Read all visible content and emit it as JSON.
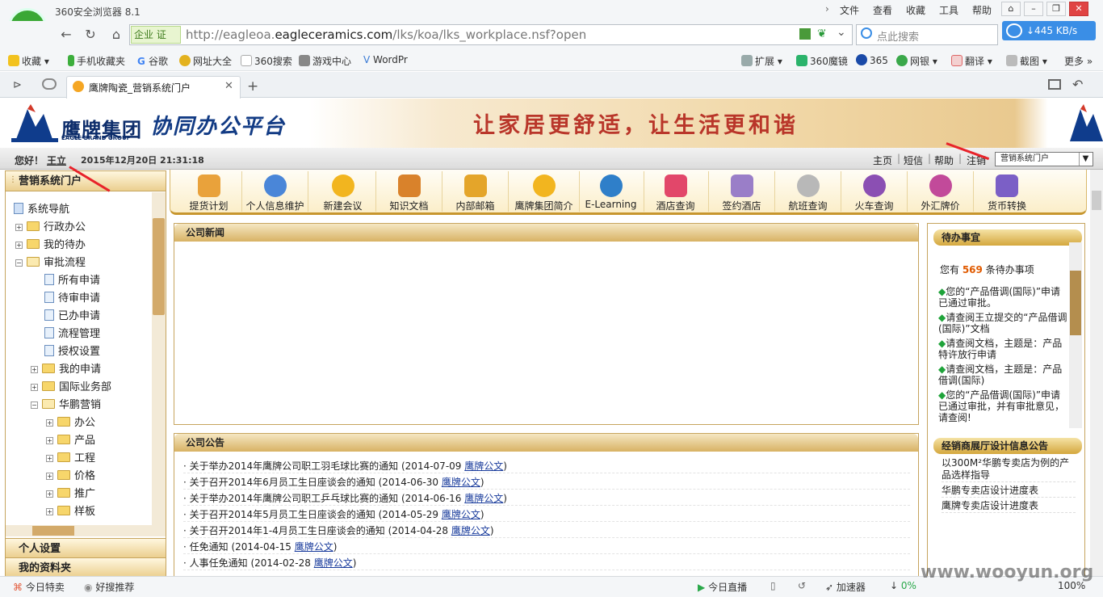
{
  "browser": {
    "title": "360安全浏览器 8.1",
    "menu": [
      "文件",
      "查看",
      "收藏",
      "工具",
      "帮助"
    ],
    "address_badge": "企业 证",
    "url_prefix": "http://eagleoa.",
    "url_domain": "eagleceramics.com",
    "url_suffix": "/lks/koa/lks_workplace.nsf?open",
    "search_placeholder": "点此搜索",
    "speed": "↓445 KB/s",
    "favorites": [
      "收藏",
      "手机收藏夹",
      "谷歌",
      "网址大全",
      "360搜索",
      "游戏中心",
      "WordPr"
    ],
    "extensions": [
      "扩展",
      "360魔镜",
      "365",
      "网银",
      "翻译",
      "截图",
      "更多"
    ],
    "tab_title": "鹰牌陶瓷_营销系统门户",
    "accent": "#3a8ee6"
  },
  "banner": {
    "brand_name": "鹰牌集团",
    "brand_en": "EAGLE BRAND GROUP",
    "platform": "协同办公平台",
    "slogan": "让家居更舒适，让生活更和谐"
  },
  "userbar": {
    "greeting": "您好！",
    "user": "王立",
    "datetime": "2015年12月20日 21:31:18",
    "links": [
      "主页",
      "短信",
      "帮助",
      "注销"
    ],
    "portal": "营销系统门户"
  },
  "left": {
    "header": "营销系统门户",
    "tree": [
      {
        "label": "系统导航",
        "level": 0,
        "kind": "root"
      },
      {
        "label": "行政办公",
        "level": 1,
        "kind": "folder",
        "exp": "+"
      },
      {
        "label": "我的待办",
        "level": 1,
        "kind": "folder",
        "exp": "+"
      },
      {
        "label": "审批流程",
        "level": 1,
        "kind": "folder",
        "exp": "-"
      },
      {
        "label": "所有申请",
        "level": 2,
        "kind": "doc"
      },
      {
        "label": "待审申请",
        "level": 2,
        "kind": "doc"
      },
      {
        "label": "已办申请",
        "level": 2,
        "kind": "doc"
      },
      {
        "label": "流程管理",
        "level": 2,
        "kind": "doc"
      },
      {
        "label": "授权设置",
        "level": 2,
        "kind": "doc"
      },
      {
        "label": "我的申请",
        "level": 2,
        "kind": "folder",
        "exp": "+"
      },
      {
        "label": "国际业务部",
        "level": 2,
        "kind": "folder",
        "exp": "+"
      },
      {
        "label": "华鹏营销",
        "level": 2,
        "kind": "folder",
        "exp": "-"
      },
      {
        "label": "办公",
        "level": 3,
        "kind": "folder",
        "exp": "+"
      },
      {
        "label": "产品",
        "level": 3,
        "kind": "folder",
        "exp": "+"
      },
      {
        "label": "工程",
        "level": 3,
        "kind": "folder",
        "exp": "+"
      },
      {
        "label": "价格",
        "level": 3,
        "kind": "folder",
        "exp": "+"
      },
      {
        "label": "推广",
        "level": 3,
        "kind": "folder",
        "exp": "+"
      },
      {
        "label": "样板",
        "level": 3,
        "kind": "folder",
        "exp": "+"
      }
    ],
    "sections": [
      "个人设置",
      "我的资料夹"
    ]
  },
  "toolbar": [
    {
      "label": "提货计划",
      "color": "#e9a23b"
    },
    {
      "label": "个人信息维护",
      "color": "#4a86d8"
    },
    {
      "label": "新建会议",
      "color": "#f2b51f"
    },
    {
      "label": "知识文档",
      "color": "#d9822b"
    },
    {
      "label": "内部邮箱",
      "color": "#e4a52a"
    },
    {
      "label": "鹰牌集团简介",
      "color": "#f2b51f"
    },
    {
      "label": "E-Learning",
      "color": "#2f7fc9"
    },
    {
      "label": "酒店查询",
      "color": "#e2476a"
    },
    {
      "label": "签约酒店",
      "color": "#9a7ec8"
    },
    {
      "label": "航班查询",
      "color": "#b8b8b8"
    },
    {
      "label": "火车查询",
      "color": "#8b4fb3"
    },
    {
      "label": "外汇牌价",
      "color": "#c24a9a"
    },
    {
      "label": "货币转换",
      "color": "#7b5fc6"
    }
  ],
  "news": {
    "title": "公司新闻"
  },
  "notice": {
    "title": "公司公告",
    "tag": "鹰牌公文",
    "items": [
      {
        "text": "关于举办2014年鹰牌公司职工羽毛球比赛的通知 (2014-07-09 ",
        "tag": "鹰牌公文"
      },
      {
        "text": "关于召开2014年6月员工生日座谈会的通知 (2014-06-30 ",
        "tag": "鹰牌公文"
      },
      {
        "text": "关于举办2014年鹰牌公司职工乒乓球比赛的通知 (2014-06-16 ",
        "tag": "鹰牌公文"
      },
      {
        "text": "关于召开2014年5月员工生日座谈会的通知 (2014-05-29 ",
        "tag": "鹰牌公文"
      },
      {
        "text": "关于召开2014年1-4月员工生日座谈会的通知 (2014-04-28 ",
        "tag": "鹰牌公文"
      },
      {
        "text": "任免通知 (2014-04-15 ",
        "tag": "鹰牌公文"
      },
      {
        "text": "人事任免通知 (2014-02-28 ",
        "tag": "鹰牌公文"
      }
    ]
  },
  "todo": {
    "title": "待办事宜",
    "count_prefix": "您有 ",
    "count": "569",
    "count_suffix": " 条待办事项",
    "items": [
      "您的“产品借调(国际)”申请已通过审批。",
      "请查阅王立提交的“产品借调(国际)”文档",
      "请查阅文档，主题是：产品特许放行申请",
      "请查阅文档，主题是：产品借调(国际)",
      "您的“产品借调(国际)”申请已通过审批，并有审批意见，请查阅!"
    ]
  },
  "design": {
    "title": "经销商展厅设计信息公告",
    "items": [
      "以300M²华鹏专卖店为例的产品选样指导",
      "华鹏专卖店设计进度表",
      "鹰牌专卖店设计进度表"
    ]
  },
  "status": {
    "left": [
      "今日特卖",
      "好搜推荐"
    ],
    "right": [
      "今日直播",
      "加速器",
      "0%",
      "100%"
    ],
    "watermark": "www.wooyun.org"
  }
}
